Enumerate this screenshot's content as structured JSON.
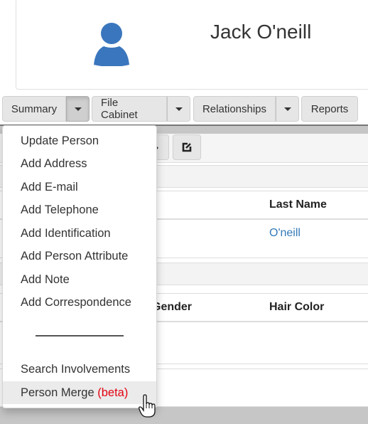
{
  "header": {
    "person_name": "Jack O'neill",
    "avatar_icon": "user-icon",
    "avatar_color": "#3a76bd"
  },
  "button_bar": {
    "groups": [
      {
        "label": "Summary",
        "has_dropdown": true,
        "dropdown_open": true
      },
      {
        "label": "File Cabinet",
        "has_dropdown": true,
        "dropdown_open": false
      },
      {
        "label": "Relationships",
        "has_dropdown": true,
        "dropdown_open": false
      },
      {
        "label": "Reports",
        "has_dropdown": false
      }
    ]
  },
  "toolbar": {
    "icons": [
      "arrow-down-icon",
      "edit-icon"
    ]
  },
  "names_table": {
    "headers": [
      "",
      "Last Name"
    ],
    "rows": [
      {
        "last_name": "O'neill"
      }
    ],
    "link_color": "#337ab7"
  },
  "attributes_table": {
    "headers": [
      "Gender",
      "Hair Color"
    ],
    "rows": []
  },
  "summary_menu": {
    "items": [
      "Update Person",
      "Add Address",
      "Add E-mail",
      "Add Telephone",
      "Add Identification",
      "Add Person Attribute",
      "Add Note",
      "Add Correspondence"
    ],
    "divider": "____________",
    "after_divider": [
      {
        "label": "Search Involvements"
      },
      {
        "label": "Person Merge",
        "badge": "(beta)",
        "hovered": true
      }
    ],
    "badge_color": "#e3000f"
  },
  "cursor": "hand-pointer-icon"
}
